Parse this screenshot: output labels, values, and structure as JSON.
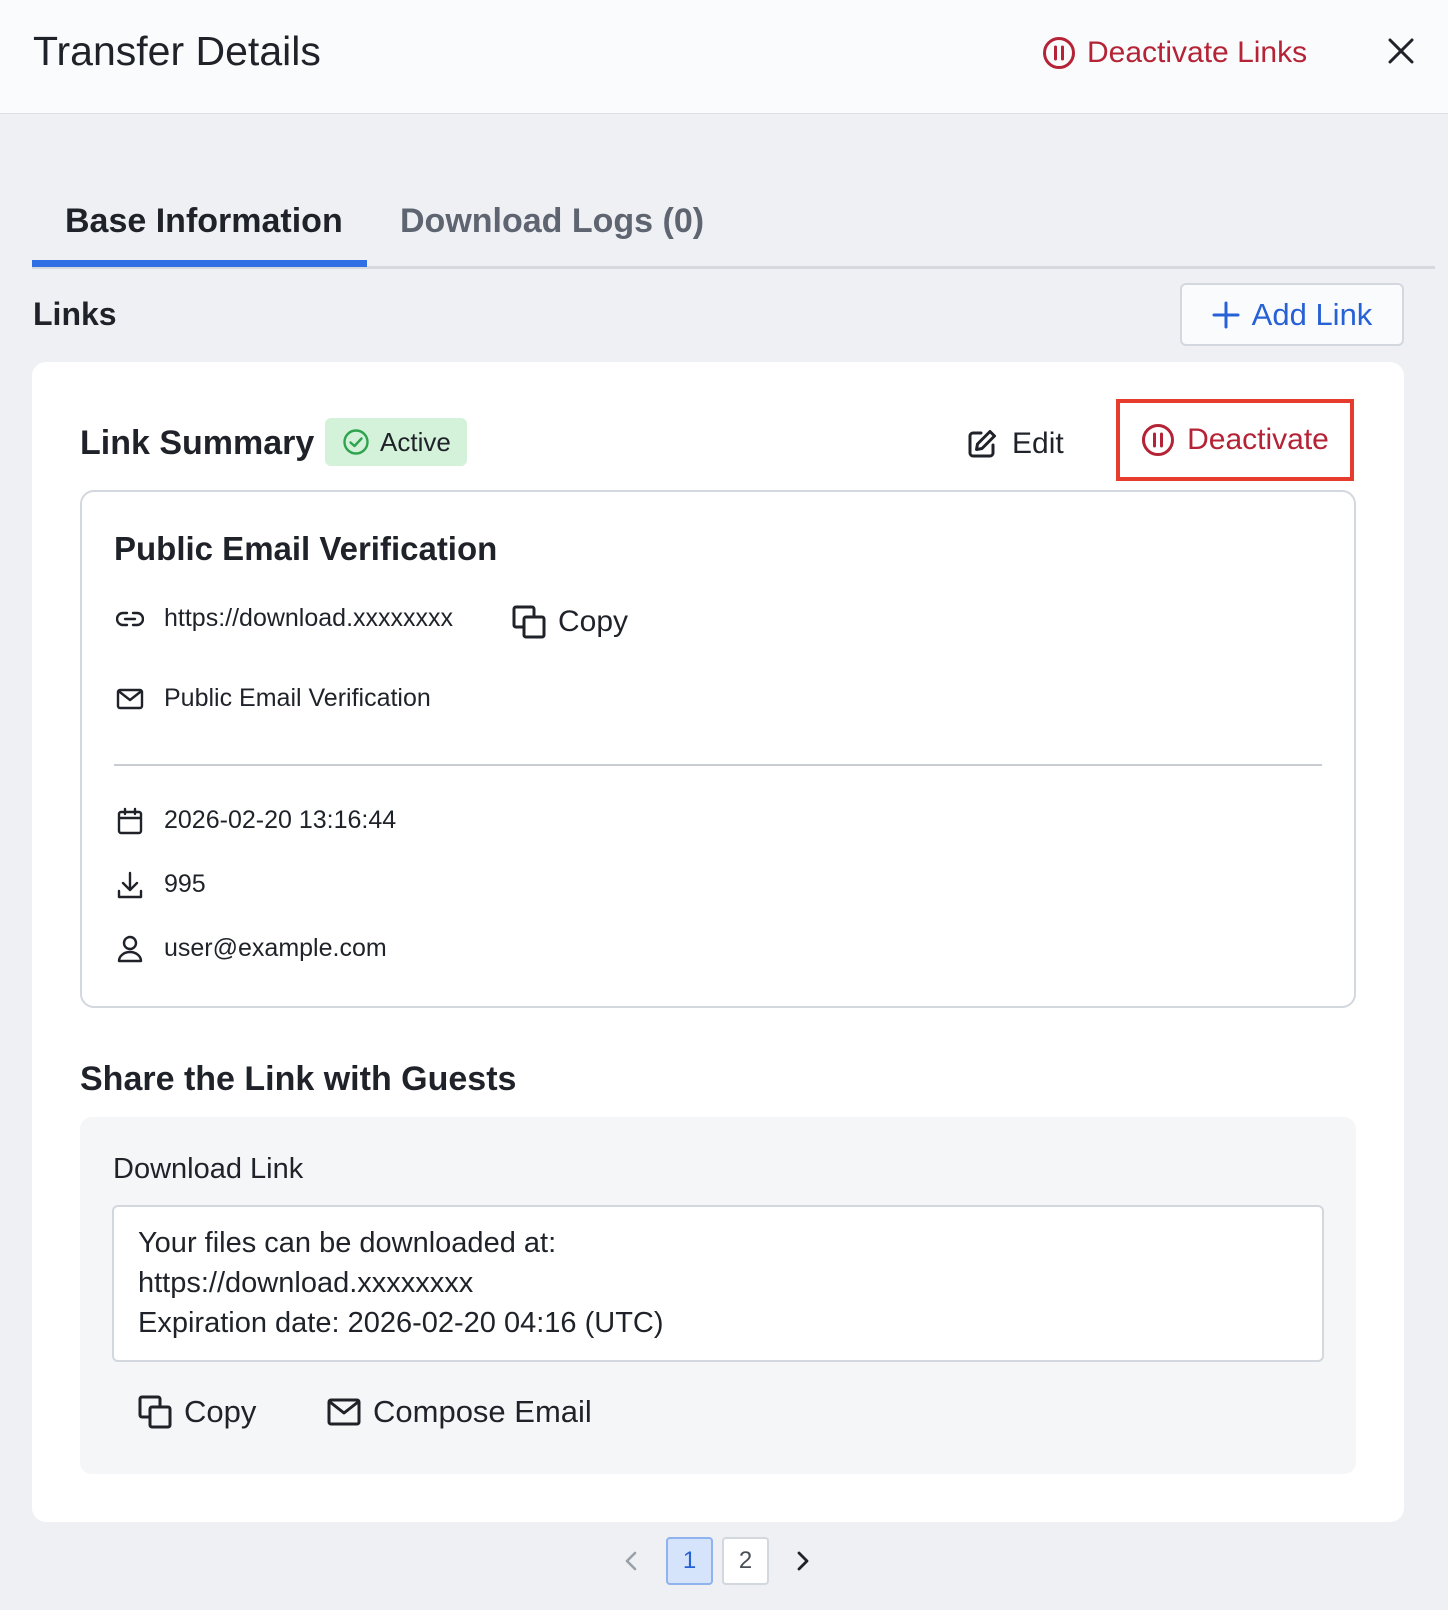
{
  "header": {
    "title": "Transfer Details",
    "deactivate_links_label": "Deactivate Links",
    "close_icon": "close-icon"
  },
  "tabs": [
    {
      "label": "Base Information",
      "active": true
    },
    {
      "label": "Download Logs (0)",
      "active": false
    }
  ],
  "links_section": {
    "title": "Links",
    "add_link_label": "Add Link"
  },
  "link_summary": {
    "title": "Link Summary",
    "status": "Active",
    "edit_label": "Edit",
    "deactivate_label": "Deactivate",
    "name": "Public Email Verification",
    "url": "https://download.xxxxxxxx",
    "copy_label": "Copy",
    "verification": "Public Email Verification",
    "date": "2026-02-20 13:16:44",
    "downloads": "995",
    "user": "user@example.com"
  },
  "share": {
    "title": "Share the Link with Guests",
    "download_link_label": "Download Link",
    "message_lines": [
      "Your files can be downloaded at:",
      "https://download.xxxxxxxx",
      "Expiration date: 2026-02-20 04:16 (UTC)"
    ],
    "copy_label": "Copy",
    "compose_email_label": "Compose Email"
  },
  "pagination": {
    "pages": [
      "1",
      "2"
    ],
    "current_page": "1"
  },
  "colors": {
    "accent_blue": "#2f6fe4",
    "danger_red": "#b42336",
    "highlight_red": "#e63c2e",
    "active_badge_bg": "#d4f1d9",
    "active_badge_icon": "#2ea44f"
  }
}
